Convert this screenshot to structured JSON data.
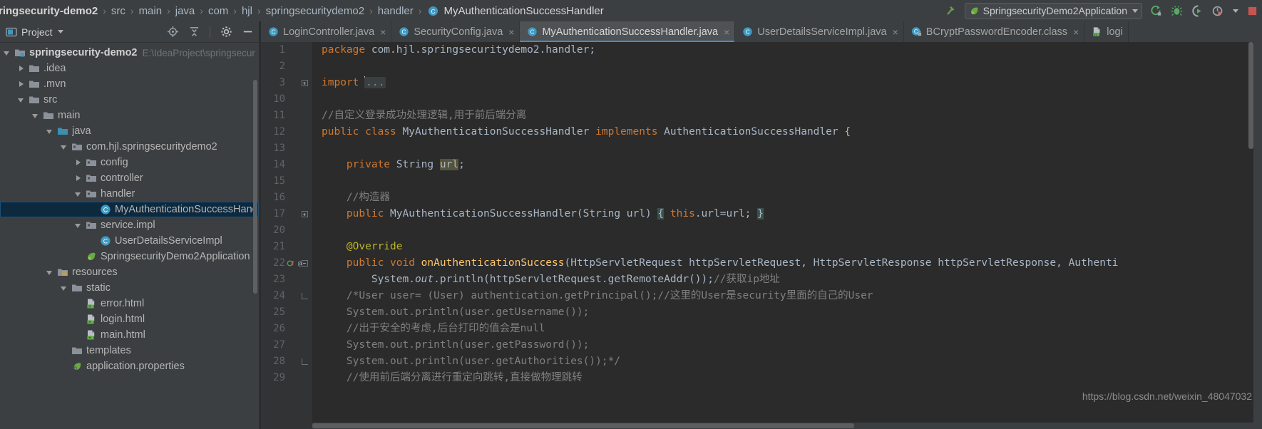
{
  "breadcrumb": {
    "items": [
      {
        "label": "ringsecurity-demo2",
        "type": "module"
      },
      {
        "label": "src",
        "type": "dir"
      },
      {
        "label": "main",
        "type": "dir"
      },
      {
        "label": "java",
        "type": "dir"
      },
      {
        "label": "com",
        "type": "dir"
      },
      {
        "label": "hjl",
        "type": "dir"
      },
      {
        "label": "springsecuritydemo2",
        "type": "dir"
      },
      {
        "label": "handler",
        "type": "dir"
      },
      {
        "label": "MyAuthenticationSuccessHandler",
        "type": "class"
      }
    ],
    "separator": "›"
  },
  "toolbar": {
    "build_icon": "hammer-icon",
    "run_config": "SpringsecurityDemo2Application",
    "run_icon": "run-icon",
    "debug_icon": "debug-icon",
    "run_coverage_icon": "run-with-coverage-icon",
    "profiler_icon": "profiler-icon",
    "stop_icon": "stop-icon",
    "dropdown_icon": "chevron-down-icon"
  },
  "project_pane": {
    "title": "Project",
    "title_icon": "project-icon",
    "dropdown_icon": "chevron-down-icon",
    "locate_icon": "scroll-from-source-icon",
    "collapse_icon": "collapse-all-icon",
    "settings_icon": "gear-icon",
    "hide_icon": "hide-icon",
    "tree": [
      {
        "label": "springsecurity-demo2",
        "path": "E:\\IdeaProject\\springsecur",
        "indent": 0,
        "twisty": "open",
        "icon": "module-icon",
        "bold": true,
        "selected": false
      },
      {
        "label": ".idea",
        "indent": 1,
        "twisty": "closed",
        "icon": "folder-icon",
        "selected": false
      },
      {
        "label": ".mvn",
        "indent": 1,
        "twisty": "closed",
        "icon": "folder-icon",
        "selected": false
      },
      {
        "label": "src",
        "indent": 1,
        "twisty": "open",
        "icon": "folder-icon",
        "selected": false
      },
      {
        "label": "main",
        "indent": 2,
        "twisty": "open",
        "icon": "folder-icon",
        "selected": false
      },
      {
        "label": "java",
        "indent": 3,
        "twisty": "open",
        "icon": "source-folder-icon",
        "selected": false
      },
      {
        "label": "com.hjl.springsecuritydemo2",
        "indent": 4,
        "twisty": "open",
        "icon": "package-icon",
        "selected": false
      },
      {
        "label": "config",
        "indent": 5,
        "twisty": "closed",
        "icon": "package-icon",
        "selected": false
      },
      {
        "label": "controller",
        "indent": 5,
        "twisty": "closed",
        "icon": "package-icon",
        "selected": false
      },
      {
        "label": "handler",
        "indent": 5,
        "twisty": "open",
        "icon": "package-icon",
        "selected": false
      },
      {
        "label": "MyAuthenticationSuccessHandl",
        "indent": 6,
        "twisty": "none",
        "icon": "java-class-icon",
        "selected": true
      },
      {
        "label": "service.impl",
        "indent": 5,
        "twisty": "open",
        "icon": "package-icon",
        "selected": false
      },
      {
        "label": "UserDetailsServiceImpl",
        "indent": 6,
        "twisty": "none",
        "icon": "java-class-icon",
        "selected": false
      },
      {
        "label": "SpringsecurityDemo2Application",
        "indent": 5,
        "twisty": "none",
        "icon": "spring-boot-icon",
        "selected": false
      },
      {
        "label": "resources",
        "indent": 3,
        "twisty": "open",
        "icon": "resources-folder-icon",
        "selected": false
      },
      {
        "label": "static",
        "indent": 4,
        "twisty": "open",
        "icon": "folder-icon",
        "selected": false
      },
      {
        "label": "error.html",
        "indent": 5,
        "twisty": "none",
        "icon": "html-file-icon",
        "selected": false
      },
      {
        "label": "login.html",
        "indent": 5,
        "twisty": "none",
        "icon": "html-file-icon",
        "selected": false
      },
      {
        "label": "main.html",
        "indent": 5,
        "twisty": "none",
        "icon": "html-file-icon",
        "selected": false
      },
      {
        "label": "templates",
        "indent": 4,
        "twisty": "none",
        "icon": "folder-icon",
        "selected": false
      },
      {
        "label": "application.properties",
        "indent": 4,
        "twisty": "none",
        "icon": "spring-properties-icon",
        "selected": false
      }
    ]
  },
  "editor_tabs": [
    {
      "label": "LoginController.java",
      "icon": "java-class-icon",
      "active": false,
      "close": "×"
    },
    {
      "label": "SecurityConfig.java",
      "icon": "java-class-icon",
      "active": false,
      "close": "×"
    },
    {
      "label": "MyAuthenticationSuccessHandler.java",
      "icon": "java-class-icon",
      "active": true,
      "close": "×"
    },
    {
      "label": "UserDetailsServiceImpl.java",
      "icon": "java-class-icon",
      "active": false,
      "close": "×"
    },
    {
      "label": "BCryptPasswordEncoder.class",
      "icon": "java-compiled-class-icon",
      "active": false,
      "close": "×"
    },
    {
      "label": "logi",
      "icon": "html-file-icon",
      "active": false,
      "close": ""
    }
  ],
  "editor": {
    "lines": [
      {
        "num": "1",
        "fold": "none"
      },
      {
        "num": "2",
        "fold": "none"
      },
      {
        "num": "3",
        "fold": "plus"
      },
      {
        "num": "10",
        "fold": "none"
      },
      {
        "num": "11",
        "fold": "none"
      },
      {
        "num": "12",
        "fold": "none"
      },
      {
        "num": "13",
        "fold": "none"
      },
      {
        "num": "14",
        "fold": "none"
      },
      {
        "num": "15",
        "fold": "none"
      },
      {
        "num": "16",
        "fold": "none"
      },
      {
        "num": "17",
        "fold": "plus"
      },
      {
        "num": "20",
        "fold": "none"
      },
      {
        "num": "21",
        "fold": "none"
      },
      {
        "num": "22",
        "fold": "tick",
        "marks": "override-implement-marker"
      },
      {
        "num": "23",
        "fold": "none"
      },
      {
        "num": "24",
        "fold": "tick"
      },
      {
        "num": "25",
        "fold": "none"
      },
      {
        "num": "26",
        "fold": "none"
      },
      {
        "num": "27",
        "fold": "none"
      },
      {
        "num": "28",
        "fold": "tick"
      },
      {
        "num": "29",
        "fold": "none"
      }
    ],
    "code": {
      "l1_package_kw": "package",
      "l1_name": " com.hjl.springsecuritydemo2.handler;",
      "l3_import_kw": "import",
      "l3_fold": "...",
      "l11_comment": "//自定义登录成功处理逻辑,用于前后端分离",
      "l12_a": "public class",
      "l12_b": " MyAuthenticationSuccessHandler ",
      "l12_c": "implements",
      "l12_d": " AuthenticationSuccessHandler {",
      "l14_a": "private",
      "l14_b": " String ",
      "l14_c": "url",
      "l14_d": ";",
      "l16_comment": "//构造器",
      "l17_a": "public",
      "l17_b": " MyAuthenticationSuccessHandler(String url) ",
      "l17_c": "{",
      "l17_d": " ",
      "l17_e": "this",
      "l17_f": ".url=url; ",
      "l17_g": "}",
      "l21_annotation": "@Override",
      "l22_a": "public void",
      "l22_b": " onAuthenticationSuccess",
      "l22_c": "(HttpServletRequest httpServletRequest, HttpServletResponse httpServletResponse, Authenti",
      "l23_a": "    System.",
      "l23_b": "out",
      "l23_c": ".println(httpServletRequest.getRemoteAddr());",
      "l23_d": "//获取ip地址",
      "l24": "    /*User user= (User) authentication.getPrincipal();//这里的User是security里面的自己的User",
      "l25": "    System.out.println(user.getUsername());",
      "l26": "    //出于安全的考虑,后台打印的值会是null",
      "l27": "    System.out.println(user.getPassword());",
      "l28": "    System.out.println(user.getAuthorities());*/",
      "l29": "    //使用前后端分离进行重定向跳转,直接做物理跳转"
    }
  },
  "watermark": "https://blog.csdn.net/weixin_48047032",
  "colors": {
    "editor_bg": "#2b2b2b",
    "panel_bg": "#3c3f41",
    "gutter_bg": "#313335",
    "keyword": "#cc7832",
    "comment": "#808080",
    "annotation": "#bbb529",
    "method": "#ffc66d",
    "text": "#a9b7c6",
    "selection": "#0d293e",
    "tab_active": "#4e5254",
    "tab_underline": "#4a88c7"
  }
}
